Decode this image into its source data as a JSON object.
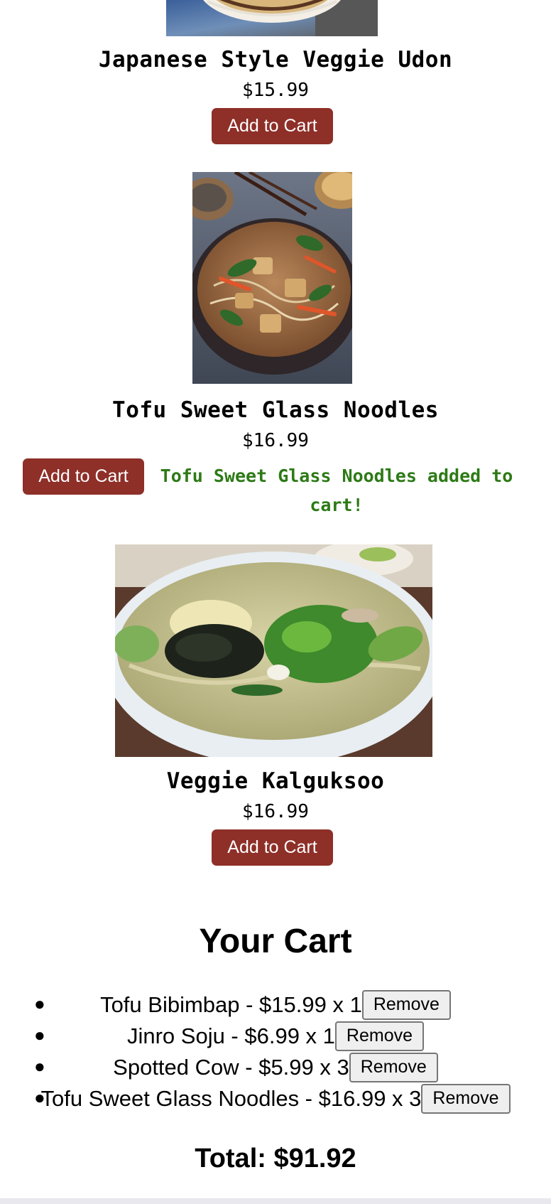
{
  "menu": {
    "items": [
      {
        "name": "Japanese Style Veggie Udon",
        "price": "$15.99",
        "button": "Add to Cart",
        "image_alt": "udon bowl"
      },
      {
        "name": "Tofu Sweet Glass Noodles",
        "price": "$16.99",
        "button": "Add to Cart",
        "image_alt": "glass noodles bowl",
        "status": "Tofu Sweet Glass Noodles added to cart!"
      },
      {
        "name": "Veggie Kalguksoo",
        "price": "$16.99",
        "button": "Add to Cart",
        "image_alt": "kalguksoo bowl"
      }
    ]
  },
  "cart": {
    "title": "Your Cart",
    "items": [
      {
        "text": "Tofu Bibimbap - $15.99 x 1",
        "button": "Remove"
      },
      {
        "text": "Jinro Soju - $6.99 x 1",
        "button": "Remove"
      },
      {
        "text": "Spotted Cow - $5.99 x 3",
        "button": "Remove"
      },
      {
        "text": "Tofu Sweet Glass Noodles - $16.99 x 3",
        "button": "Remove"
      }
    ],
    "total": "Total: $91.92"
  },
  "colors": {
    "add_button": "#8e2f28",
    "success_text": "#2d7a16"
  }
}
